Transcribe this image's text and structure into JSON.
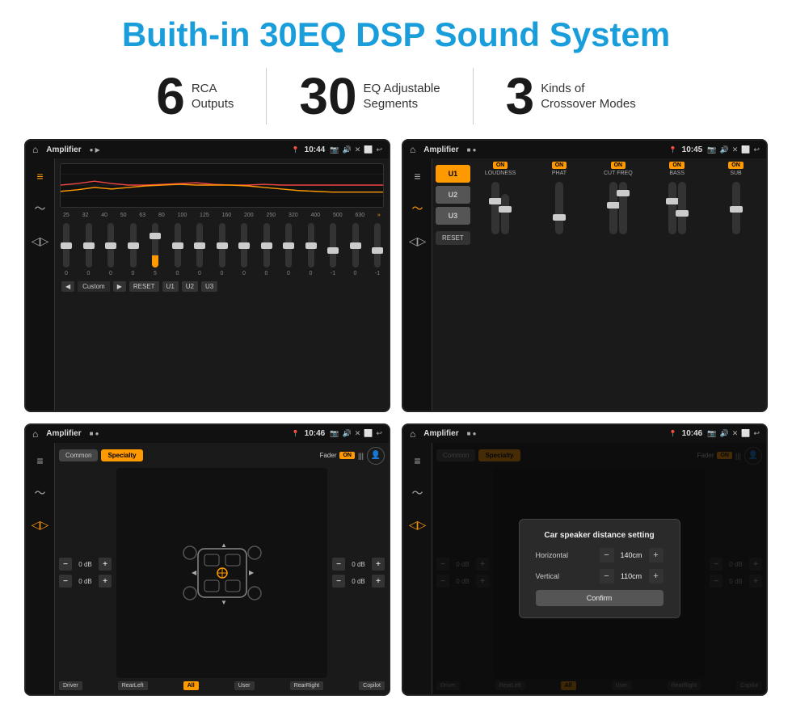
{
  "page": {
    "title": "Buith-in 30EQ DSP Sound System",
    "bg": "#ffffff"
  },
  "stats": [
    {
      "number": "6",
      "label_line1": "RCA",
      "label_line2": "Outputs"
    },
    {
      "number": "30",
      "label_line1": "EQ Adjustable",
      "label_line2": "Segments"
    },
    {
      "number": "3",
      "label_line1": "Kinds of",
      "label_line2": "Crossover Modes"
    }
  ],
  "screens": [
    {
      "id": "screen1",
      "title": "Amplifier",
      "time": "10:44",
      "type": "eq",
      "freq_labels": [
        "25",
        "32",
        "40",
        "50",
        "63",
        "80",
        "100",
        "125",
        "160",
        "200",
        "250",
        "320",
        "400",
        "500",
        "630"
      ],
      "sliders": [
        0,
        0,
        0,
        0,
        5,
        0,
        0,
        0,
        0,
        0,
        0,
        0,
        -1,
        0,
        -1
      ],
      "bottom_btns": [
        "Custom",
        "RESET",
        "U1",
        "U2",
        "U3"
      ]
    },
    {
      "id": "screen2",
      "title": "Amplifier",
      "time": "10:45",
      "type": "crossover",
      "presets": [
        "U1",
        "U2",
        "U3"
      ],
      "channels": [
        {
          "label": "LOUDNESS",
          "on": true
        },
        {
          "label": "PHAT",
          "on": true
        },
        {
          "label": "CUT FREQ",
          "on": true
        },
        {
          "label": "BASS",
          "on": true
        },
        {
          "label": "SUB",
          "on": true
        }
      ]
    },
    {
      "id": "screen3",
      "title": "Amplifier",
      "time": "10:46",
      "type": "fader",
      "tabs": [
        "Common",
        "Specialty"
      ],
      "fader_label": "Fader",
      "vol_rows": [
        {
          "left": "0 dB",
          "right": "0 dB"
        },
        {
          "left": "0 dB",
          "right": "0 dB"
        }
      ],
      "bottom_labels": [
        "Driver",
        "RearLeft",
        "All",
        "User",
        "RearRight",
        "Copilot"
      ]
    },
    {
      "id": "screen4",
      "title": "Amplifier",
      "time": "10:46",
      "type": "fader_dialog",
      "tabs": [
        "Common",
        "Specialty"
      ],
      "dialog": {
        "title": "Car speaker distance setting",
        "rows": [
          {
            "label": "Horizontal",
            "value": "140cm"
          },
          {
            "label": "Vertical",
            "value": "110cm"
          }
        ],
        "confirm_label": "Confirm"
      }
    }
  ]
}
